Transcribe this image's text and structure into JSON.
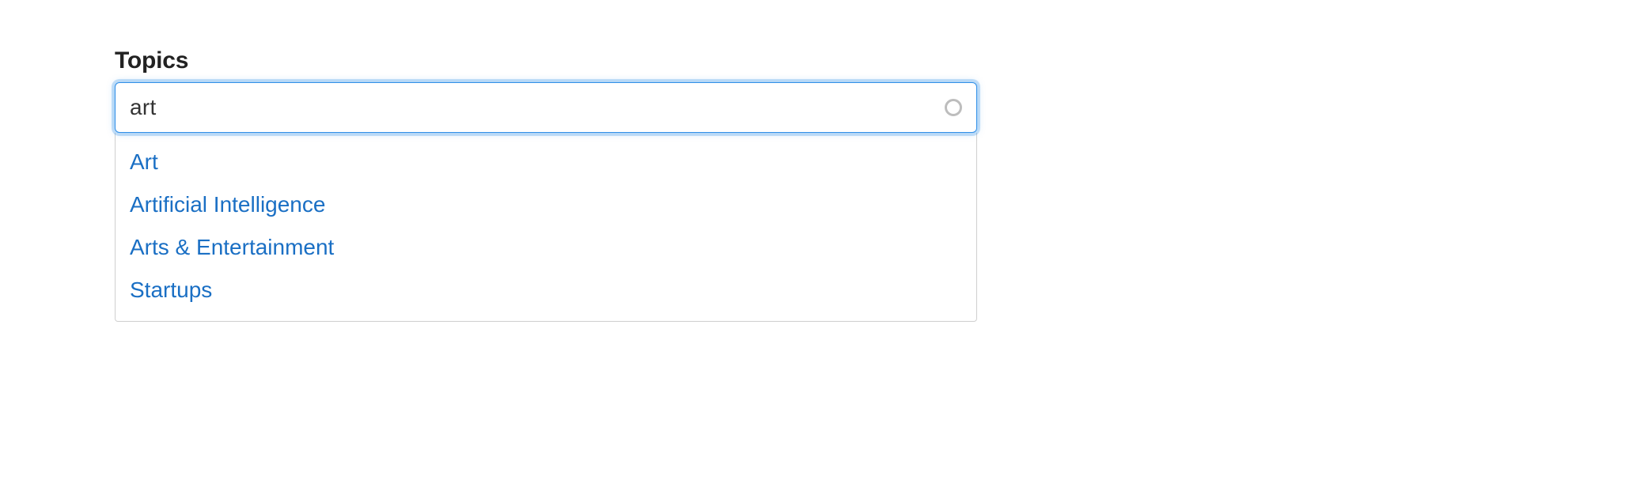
{
  "field": {
    "label": "Topics",
    "value": "art",
    "placeholder": ""
  },
  "suggestions": [
    "Art",
    "Artificial Intelligence",
    "Arts & Entertainment",
    "Startups"
  ]
}
